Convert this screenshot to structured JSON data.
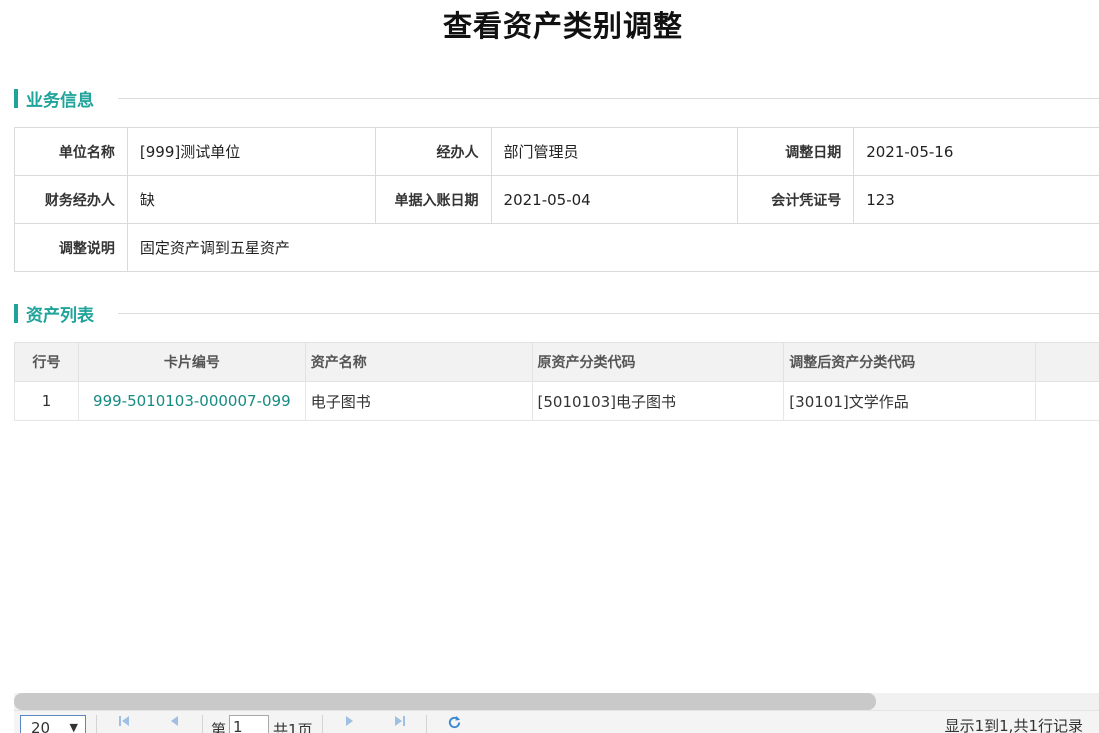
{
  "title": "查看资产类别调整",
  "sections": {
    "business_info": "业务信息",
    "asset_list": "资产列表"
  },
  "business_info": {
    "unit_label": "单位名称",
    "unit_value": "[999]测试单位",
    "handler_label": "经办人",
    "handler_value": "部门管理员",
    "adjust_date_label": "调整日期",
    "adjust_date_value": "2021-05-16",
    "finance_handler_label": "财务经办人",
    "finance_handler_value": "缺",
    "entry_date_label": "单据入账日期",
    "entry_date_value": "2021-05-04",
    "voucher_label": "会计凭证号",
    "voucher_value": "123",
    "remark_label": "调整说明",
    "remark_value": "固定资产调到五星资产"
  },
  "asset_table": {
    "headers": {
      "row_no": "行号",
      "card_no": "卡片编号",
      "asset_name": "资产名称",
      "orig_code": "原资产分类代码",
      "new_code": "调整后资产分类代码"
    },
    "rows": [
      {
        "row_no": "1",
        "card_no": "999-5010103-000007-099",
        "asset_name": "电子图书",
        "orig_code": "[5010103]电子图书",
        "new_code": "[30101]文学作品"
      }
    ]
  },
  "pager": {
    "page_size": "20",
    "page_prefix": "第",
    "current_page": "1",
    "page_suffix": "共1页",
    "summary": "显示1到1,共1行记录"
  },
  "icons": {
    "first": "first-page-icon",
    "prev": "prev-page-icon",
    "next": "next-page-icon",
    "last": "last-page-icon",
    "refresh": "refresh-icon"
  },
  "colors": {
    "accent": "#1fa39a",
    "link": "#178a82",
    "pager_icon": "#4f8fd6"
  }
}
